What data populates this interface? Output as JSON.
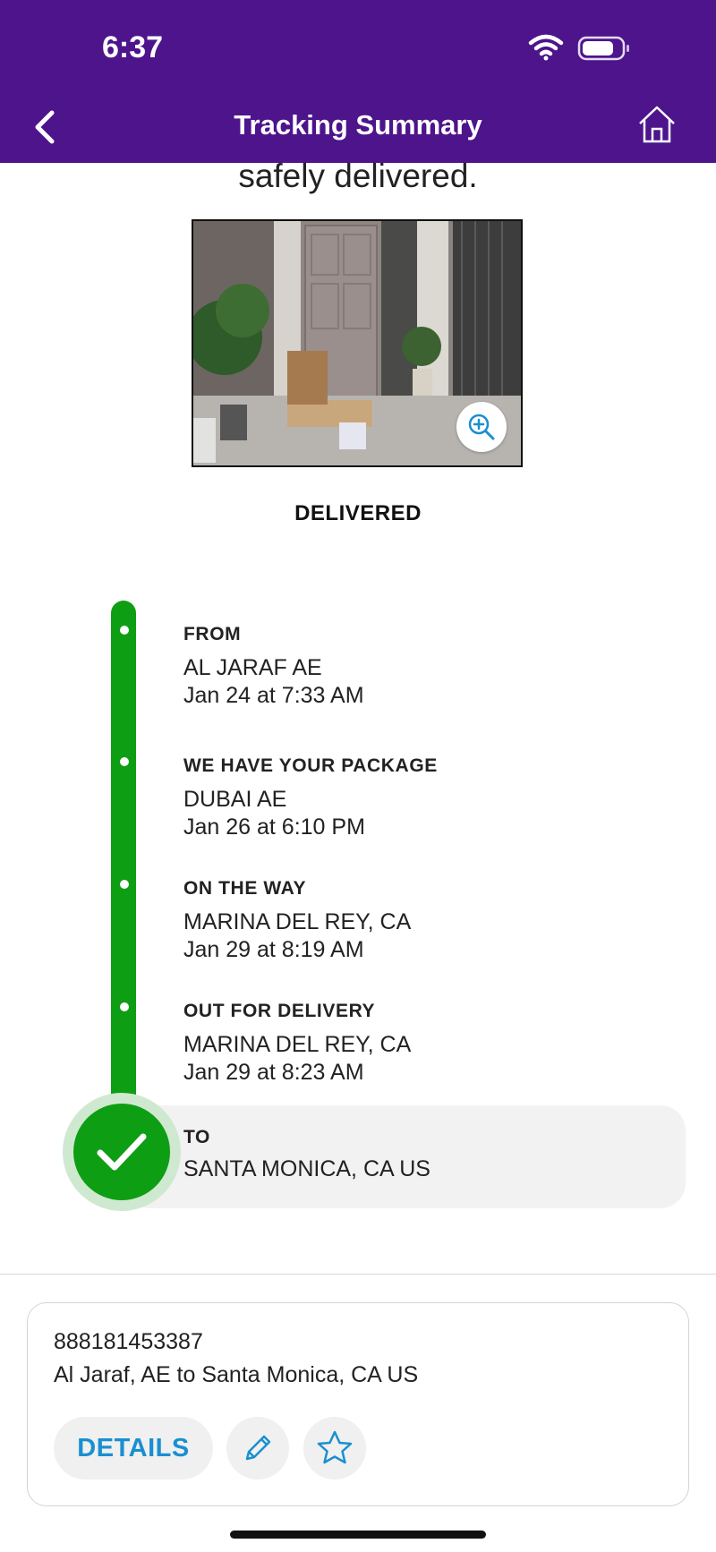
{
  "status_bar": {
    "time": "6:37"
  },
  "header": {
    "title": "Tracking Summary"
  },
  "delivery": {
    "message_fragment": "safely delivered.",
    "status": "DELIVERED"
  },
  "timeline": [
    {
      "title": "FROM",
      "location": "AL JARAF AE",
      "date": "Jan 24 at 7:33 AM"
    },
    {
      "title": "WE HAVE YOUR PACKAGE",
      "location": "DUBAI AE",
      "date": "Jan 26 at 6:10 PM"
    },
    {
      "title": "ON THE WAY",
      "location": "MARINA DEL REY, CA",
      "date": "Jan 29 at 8:19 AM"
    },
    {
      "title": "OUT FOR DELIVERY",
      "location": "MARINA DEL REY, CA",
      "date": "Jan 29 at 8:23 AM"
    },
    {
      "title": "TO",
      "location": "SANTA MONICA, CA  US",
      "date": ""
    }
  ],
  "summary_card": {
    "tracking_number": "888181453387",
    "route": "Al Jaraf, AE to Santa Monica, CA US",
    "details_label": "DETAILS"
  },
  "colors": {
    "header": "#4d148c",
    "progress": "#0e9e14",
    "accent": "#1a8fd0"
  }
}
